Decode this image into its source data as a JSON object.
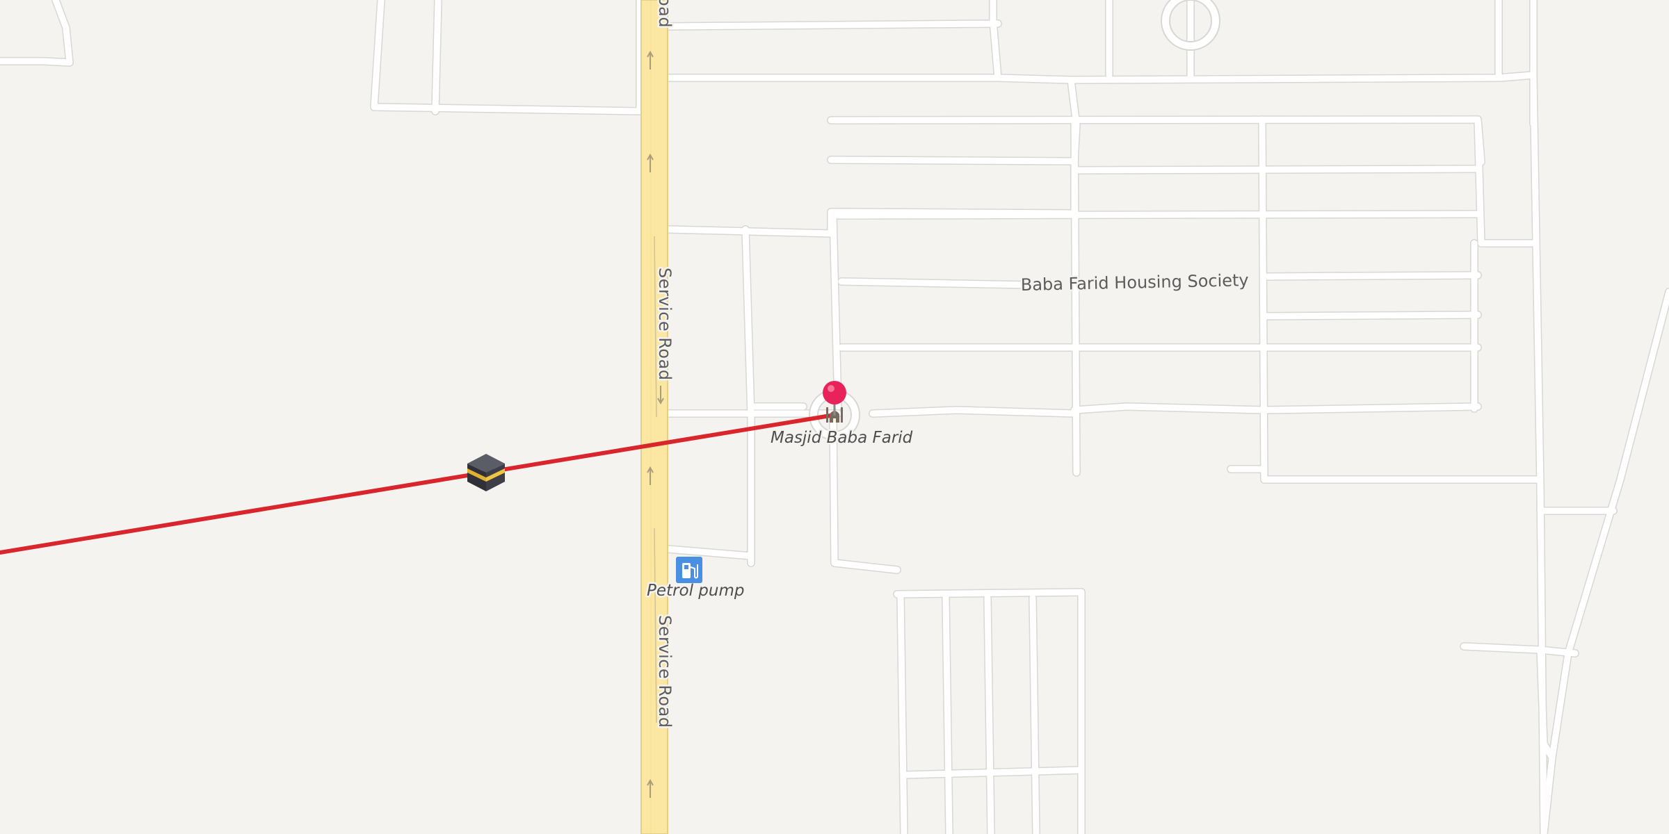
{
  "map": {
    "roads": [
      {
        "name": "Service Road",
        "label": "Service Road"
      },
      {
        "name": "Service Road",
        "label": "Service Road"
      },
      {
        "name": "Road (partial)",
        "label": "oad"
      }
    ],
    "areas": [
      {
        "label": "Baba Farid Housing Society"
      }
    ],
    "pois": [
      {
        "label": "Masjid Baba Farid",
        "icon": "mosque-icon"
      },
      {
        "label": "Petrol pump",
        "icon": "fuel-icon",
        "color": "#4a90e2"
      }
    ],
    "markers": [
      {
        "icon": "location-pin-icon",
        "color": "#e8235c"
      },
      {
        "icon": "kaaba-icon"
      }
    ],
    "qibla_line": {
      "color": "#d9262c"
    },
    "colors": {
      "land": "#f5f3f0",
      "road": "#ffffff",
      "main_road": "#fbe7a1",
      "block_outline": "#dcdad7"
    }
  }
}
